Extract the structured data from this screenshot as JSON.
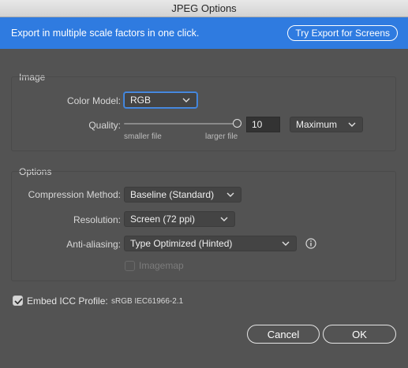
{
  "window": {
    "title": "JPEG Options"
  },
  "banner": {
    "text": "Export in multiple scale factors in one click.",
    "button_label": "Try Export for Screens"
  },
  "image_group": {
    "title": "Image",
    "color_model_label": "Color Model:",
    "color_model_value": "RGB",
    "quality_label": "Quality:",
    "quality_value": "10",
    "quality_level": 1.0,
    "smaller_file": "smaller file",
    "larger_file": "larger file",
    "quality_preset": "Maximum"
  },
  "options_group": {
    "title": "Options",
    "compression_label": "Compression Method:",
    "compression_value": "Baseline (Standard)",
    "resolution_label": "Resolution:",
    "resolution_value": "Screen (72 ppi)",
    "antialias_label": "Anti-aliasing:",
    "antialias_value": "Type Optimized (Hinted)",
    "imagemap_label": "Imagemap",
    "imagemap_checked": false,
    "imagemap_enabled": false
  },
  "icc": {
    "label": "Embed ICC Profile:",
    "profile": "sRGB IEC61966-2.1",
    "checked": true
  },
  "buttons": {
    "cancel": "Cancel",
    "ok": "OK"
  },
  "colors": {
    "background": "#535353",
    "banner": "#2f7be0",
    "focus": "#4d8fe4"
  },
  "icons": {
    "dropdown": "chevron-down-icon",
    "info": "info-icon",
    "check": "checkmark-icon"
  }
}
